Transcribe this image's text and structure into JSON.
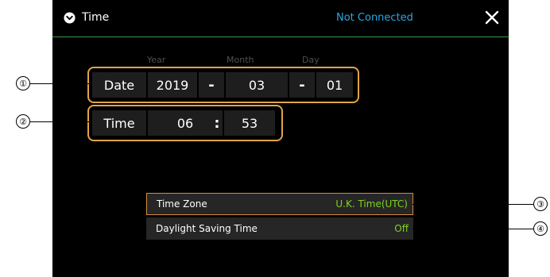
{
  "header": {
    "title": "Time",
    "status": "Not Connected"
  },
  "date": {
    "label": "Date",
    "year_caption": "Year",
    "month_caption": "Month",
    "day_caption": "Day",
    "year": "2019",
    "month": "03",
    "day": "01",
    "separator": "-"
  },
  "time": {
    "label": "Time",
    "hour": "06",
    "minute": "53",
    "separator": ":"
  },
  "settings": [
    {
      "label": "Time Zone",
      "value": "U.K. Time(UTC)"
    },
    {
      "label": "Daylight Saving Time",
      "value": "Off"
    }
  ],
  "callouts": [
    "①",
    "②",
    "③",
    "④"
  ],
  "colors": {
    "accent_orange": "#e2a44a",
    "status_blue": "#29a6e6",
    "value_green": "#7ed321",
    "header_rule_green": "#3a9a4a"
  },
  "icons": {
    "header": "clock-icon",
    "close": "close-icon"
  }
}
